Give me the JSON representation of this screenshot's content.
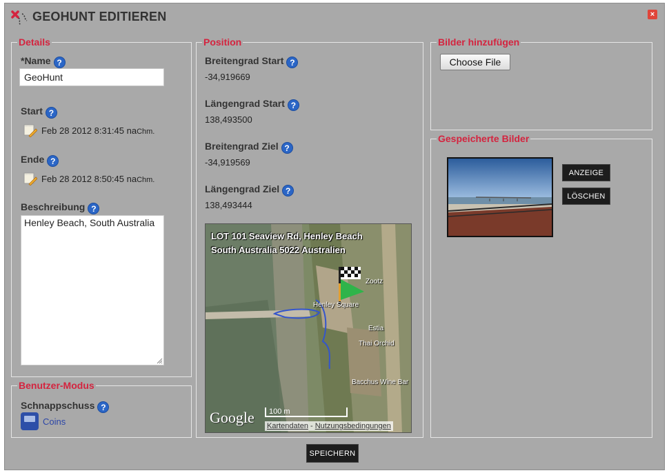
{
  "title": "GEOHUNT EDITIEREN",
  "close_label": "×",
  "details": {
    "legend": "Details",
    "name_label": "*Name",
    "name_value": "GeoHunt",
    "start_label": "Start",
    "start_date": "Feb 28 2012 8:31:45 na",
    "start_date_suffix": "Chm.",
    "end_label": "Ende",
    "end_date": "Feb 28 2012 8:50:45 na",
    "end_date_suffix": "Chm.",
    "description_label": "Beschreibung",
    "description_value": "Henley Beach, South Australia"
  },
  "mode": {
    "legend": "Benutzer-Modus",
    "snapshot_label": "Schnappschuss",
    "coins_label": "Coins"
  },
  "position": {
    "legend": "Position",
    "lat_start_label": "Breitengrad Start",
    "lat_start_value": "-34,919669",
    "lng_start_label": "Längengrad Start",
    "lng_start_value": "138,493500",
    "lat_end_label": "Breitengrad Ziel",
    "lat_end_value": "-34,919569",
    "lng_end_label": "Längengrad Ziel",
    "lng_end_value": "138,493444",
    "map": {
      "address": "LOT 101 Seaview Rd, Henley Beach South Australia 5022 Australien",
      "provider": "Google",
      "scale": "100 m",
      "map_data": "Kartendaten",
      "terms": "Nutzungsbedingungen",
      "places": [
        "Henley Square",
        "Zootz",
        "Estia",
        "Thai Orchid",
        "Bacchus Wine Bar"
      ]
    }
  },
  "add_images": {
    "legend": "Bilder hinzufügen",
    "file_button": "Choose File"
  },
  "saved_images": {
    "legend": "Gespeicherte Bilder",
    "show_button": "ANZEIGE",
    "delete_button": "LÖSCHEN"
  },
  "save_button": "SPEICHERN",
  "help_glyph": "?"
}
